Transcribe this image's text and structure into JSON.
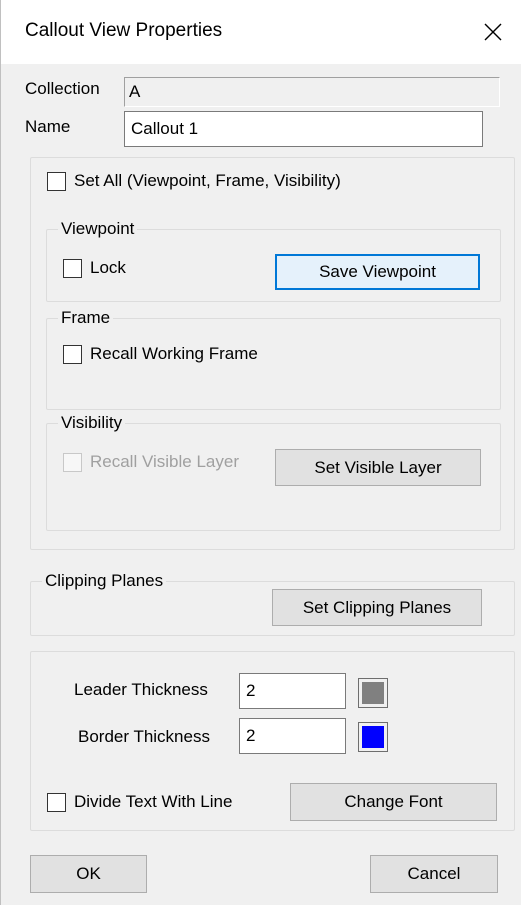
{
  "window": {
    "title": "Callout View Properties",
    "close_icon": "close-icon"
  },
  "collection": {
    "label": "Collection",
    "value": "A"
  },
  "name": {
    "label": "Name",
    "value": "Callout 1"
  },
  "set_all": {
    "label": "Set All (Viewpoint, Frame, Visibility)",
    "checked": false
  },
  "viewpoint": {
    "legend": "Viewpoint",
    "lock_label": "Lock",
    "lock_checked": false,
    "save_button": "Save Viewpoint"
  },
  "frame": {
    "legend": "Frame",
    "recall_label": "Recall Working Frame",
    "recall_checked": false
  },
  "visibility": {
    "legend": "Visibility",
    "recall_label": "Recall Visible Layer",
    "recall_checked": false,
    "recall_enabled": false,
    "set_button": "Set Visible Layer"
  },
  "clipping": {
    "legend": "Clipping Planes",
    "set_button": "Set Clipping Planes"
  },
  "leader": {
    "label": "Leader Thickness",
    "value": "2",
    "color": "#808080"
  },
  "border": {
    "label": "Border Thickness",
    "value": "2",
    "color": "#0000ff"
  },
  "divide": {
    "label": "Divide Text With Line",
    "checked": false
  },
  "change_font_button": "Change Font",
  "ok_button": "OK",
  "cancel_button": "Cancel"
}
